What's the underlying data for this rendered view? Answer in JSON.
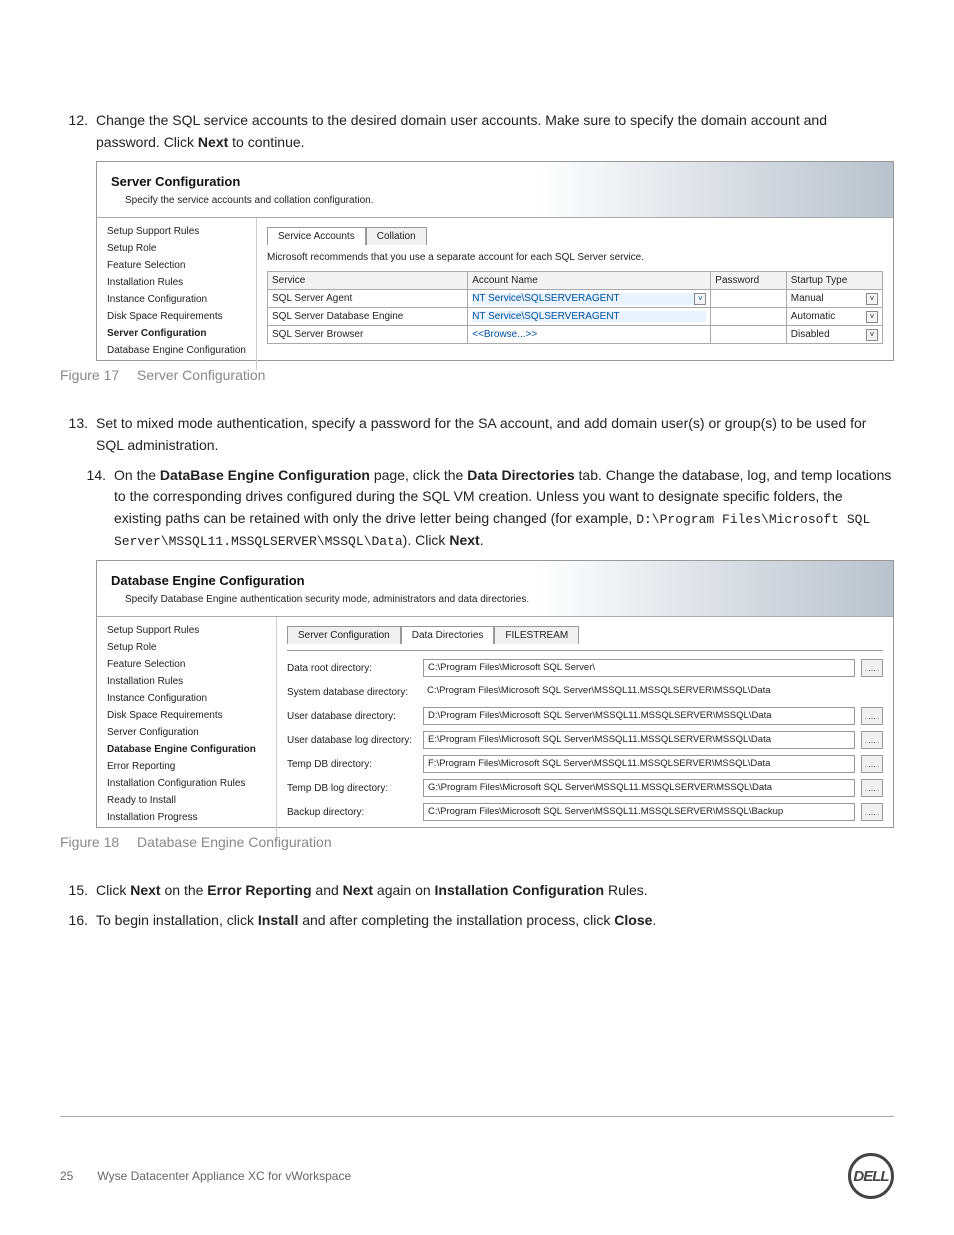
{
  "steps": {
    "s12_num": "12.",
    "s12_a": "Change the SQL service accounts to the desired domain user accounts. Make sure to specify the domain account and password. Click ",
    "s12_b": "Next",
    "s12_c": " to continue.",
    "s13_num": "13.",
    "s13": "Set to mixed mode authentication, specify a password for the SA account, and add domain user(s) or group(s) to be used for SQL administration.",
    "s14_num": "14.",
    "s14_a": "On the ",
    "s14_b": "DataBase Engine Configuration",
    "s14_c": " page, click the ",
    "s14_d": "Data Directories",
    "s14_e": " tab. Change the database, log, and temp locations to the corresponding drives configured during the SQL VM creation. Unless you want to designate specific folders, the existing paths can be retained with only the drive letter being changed (for example, ",
    "s14_code": "D:\\Program Files\\Microsoft SQL Server\\MSSQL11.MSSQLSERVER\\MSSQL\\Data",
    "s14_f": "). Click ",
    "s14_g": "Next",
    "s14_h": ".",
    "s15_num": "15.",
    "s15_a": "Click ",
    "s15_b": "Next",
    "s15_c": " on the ",
    "s15_d": "Error Reporting",
    "s15_e": " and ",
    "s15_f": "Next",
    "s15_g": " again on ",
    "s15_h": "Installation Configuration",
    "s15_i": " Rules.",
    "s16_num": "16.",
    "s16_a": "To begin installation, click ",
    "s16_b": "Install",
    "s16_c": " and after completing the installation process, click ",
    "s16_d": "Close",
    "s16_e": "."
  },
  "fig17": {
    "caption_label": "Figure 17",
    "caption_text": "Server Configuration",
    "title": "Server Configuration",
    "subtitle": "Specify the service accounts and collation configuration.",
    "side": [
      "Setup Support Rules",
      "Setup Role",
      "Feature Selection",
      "Installation Rules",
      "Instance Configuration",
      "Disk Space Requirements",
      "Server Configuration",
      "Database Engine Configuration"
    ],
    "side_bold_index": 6,
    "tab_active": "Service Accounts",
    "tab_other": "Collation",
    "note": "Microsoft recommends that you use a separate account for each SQL Server service.",
    "headers": [
      "Service",
      "Account Name",
      "Password",
      "Startup Type"
    ],
    "rows": [
      {
        "svc": "SQL Server Agent",
        "acct": "NT Service\\SQLSERVERAGENT",
        "has_dd": true,
        "startup": "Manual",
        "startup_dd": true
      },
      {
        "svc": "SQL Server Database Engine",
        "acct": "NT Service\\SQLSERVERAGENT",
        "has_dd": false,
        "startup": "Automatic",
        "startup_dd": true
      },
      {
        "svc": "SQL Server Browser",
        "acct": "<<Browse...>>",
        "browse": true,
        "startup": "Disabled",
        "startup_dd": true
      }
    ]
  },
  "fig18": {
    "caption_label": "Figure 18",
    "caption_text": "Database Engine Configuration",
    "title": "Database Engine Configuration",
    "subtitle": "Specify Database Engine authentication security mode, administrators and data directories.",
    "side": [
      "Setup Support Rules",
      "Setup Role",
      "Feature Selection",
      "Installation Rules",
      "Instance Configuration",
      "Disk Space Requirements",
      "Server Configuration",
      "Database Engine Configuration",
      "Error Reporting",
      "Installation Configuration Rules",
      "Ready to Install",
      "Installation Progress"
    ],
    "side_bold_index": 7,
    "tabs": [
      "Server Configuration",
      "Data Directories",
      "FILESTREAM"
    ],
    "tabs_active_index": 1,
    "dirs": [
      {
        "label": "Data root directory:",
        "val": "C:\\Program Files\\Microsoft SQL Server\\",
        "box": true,
        "browse": true
      },
      {
        "label": "System database directory:",
        "val": "C:\\Program Files\\Microsoft SQL Server\\MSSQL11.MSSQLSERVER\\MSSQL\\Data",
        "box": false,
        "browse": false
      },
      {
        "label": "User database directory:",
        "val": "D:\\Program Files\\Microsoft SQL Server\\MSSQL11.MSSQLSERVER\\MSSQL\\Data",
        "box": true,
        "browse": true
      },
      {
        "label": "User database log directory:",
        "val": "E:\\Program Files\\Microsoft SQL Server\\MSSQL11.MSSQLSERVER\\MSSQL\\Data",
        "box": true,
        "browse": true
      },
      {
        "label": "Temp DB directory:",
        "val": "F:\\Program Files\\Microsoft SQL Server\\MSSQL11.MSSQLSERVER\\MSSQL\\Data",
        "box": true,
        "browse": true
      },
      {
        "label": "Temp DB log directory:",
        "val": "G:\\Program Files\\Microsoft SQL Server\\MSSQL11.MSSQLSERVER\\MSSQL\\Data",
        "box": true,
        "browse": true
      },
      {
        "label": "Backup directory:",
        "val": "C:\\Program Files\\Microsoft SQL Server\\MSSQL11.MSSQLSERVER\\MSSQL\\Backup",
        "box": true,
        "browse": true
      }
    ]
  },
  "footer": {
    "page": "25",
    "doc": "Wyse Datacenter Appliance XC for vWorkspace",
    "logo": "DELL"
  },
  "icons": {
    "chev": "˅",
    "ell": "..."
  }
}
